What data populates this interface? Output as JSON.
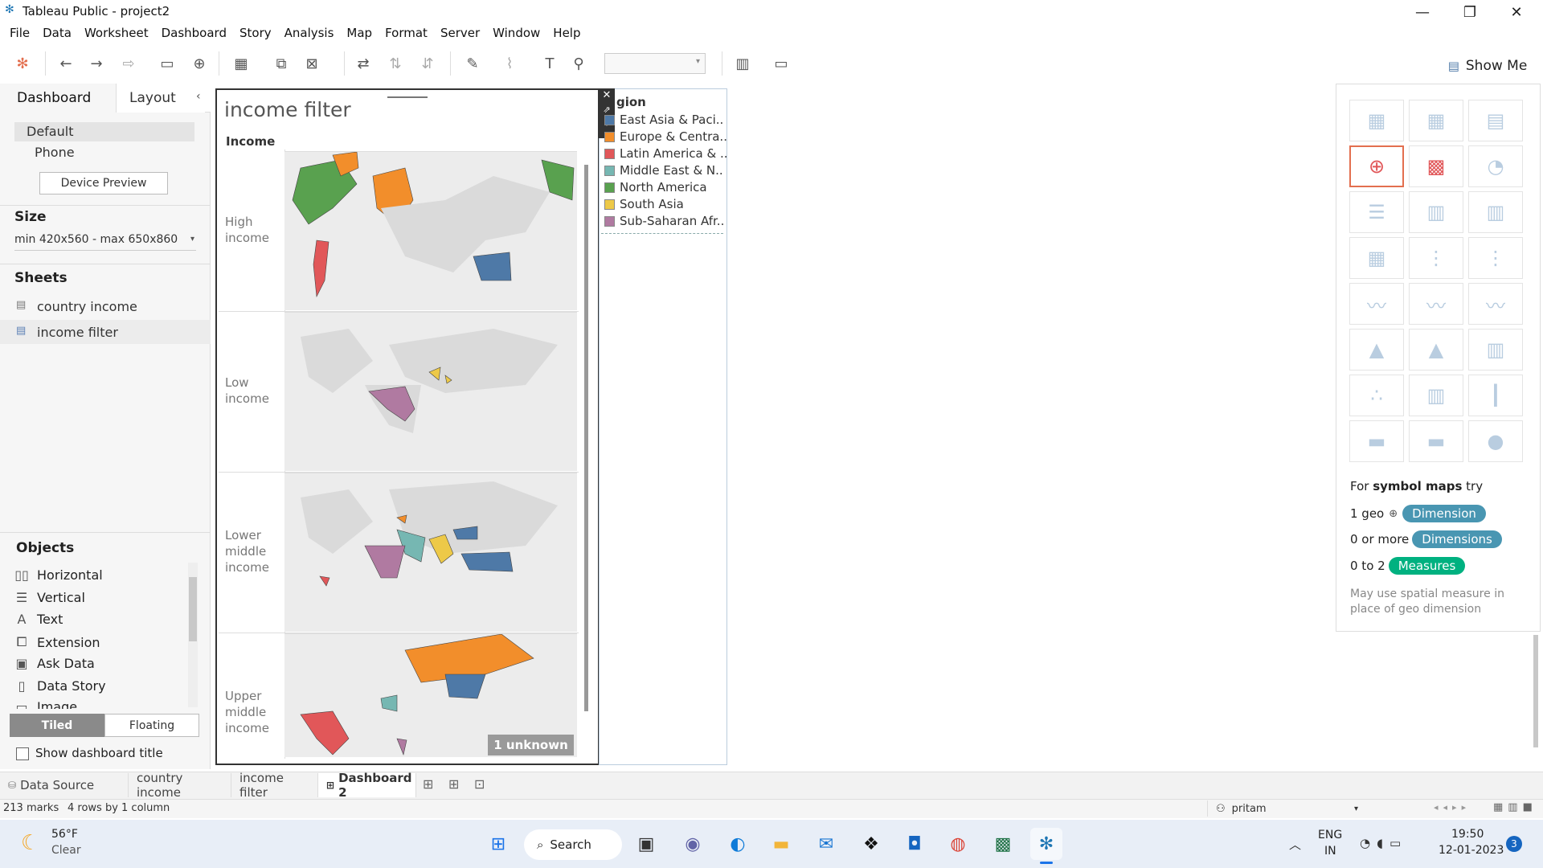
{
  "window": {
    "title": "Tableau Public - project2"
  },
  "menu": [
    "File",
    "Data",
    "Worksheet",
    "Dashboard",
    "Story",
    "Analysis",
    "Map",
    "Format",
    "Server",
    "Window",
    "Help"
  ],
  "left": {
    "tab_dashboard": "Dashboard",
    "tab_layout": "Layout",
    "device_default": "Default",
    "device_phone": "Phone",
    "device_preview": "Device Preview",
    "size_header": "Size",
    "size_value": "min 420x560 - max 650x860",
    "sheets_header": "Sheets",
    "sheets": [
      "country income",
      "income filter"
    ],
    "objects_header": "Objects",
    "objects": [
      "Horizontal",
      "Vertical",
      "Text",
      "Extension",
      "Ask Data",
      "Data Story",
      "Image"
    ],
    "tiled": "Tiled",
    "floating": "Floating",
    "show_title": "Show dashboard title"
  },
  "dashboard": {
    "title": "income filter",
    "column_header": "Income",
    "rows": [
      "High income",
      "Low income",
      "Lower middle income",
      "Upper middle income"
    ],
    "unknown_badge": "1 unknown"
  },
  "legend": {
    "title": "gion",
    "items": [
      {
        "label": "East Asia & Paci..",
        "color": "#4e79a7"
      },
      {
        "label": "Europe & Centra..",
        "color": "#f28e2b"
      },
      {
        "label": "Latin America & ..",
        "color": "#e15759"
      },
      {
        "label": "Middle East & N..",
        "color": "#76b7b2"
      },
      {
        "label": "North America",
        "color": "#59a14f"
      },
      {
        "label": "South Asia",
        "color": "#edc948"
      },
      {
        "label": "Sub-Saharan Afr..",
        "color": "#b07aa1"
      }
    ]
  },
  "showme": {
    "button": "Show Me",
    "hint_prefix": "For ",
    "hint_bold": "symbol maps",
    "hint_suffix": " try",
    "req1_label": "1 geo",
    "req1_pill": "Dimension",
    "req2_label": "0 or more",
    "req2_pill": "Dimensions",
    "req3_label": "0 to 2",
    "req3_pill": "Measures",
    "note": "May use spatial measure in place of geo dimension",
    "colors": {
      "dimension": "#4996b2",
      "measure": "#00b180"
    }
  },
  "bottom_tabs": [
    "Data Source",
    "country income",
    "income filter",
    "Dashboard 2"
  ],
  "status": {
    "marks": "213 marks",
    "dims": "4 rows by 1 column",
    "user": "pritam"
  },
  "taskbar": {
    "temp": "56°F",
    "weather": "Clear",
    "search": "Search",
    "lang1": "ENG",
    "lang2": "IN",
    "time": "19:50",
    "date": "12-01-2023",
    "badge": "3"
  }
}
